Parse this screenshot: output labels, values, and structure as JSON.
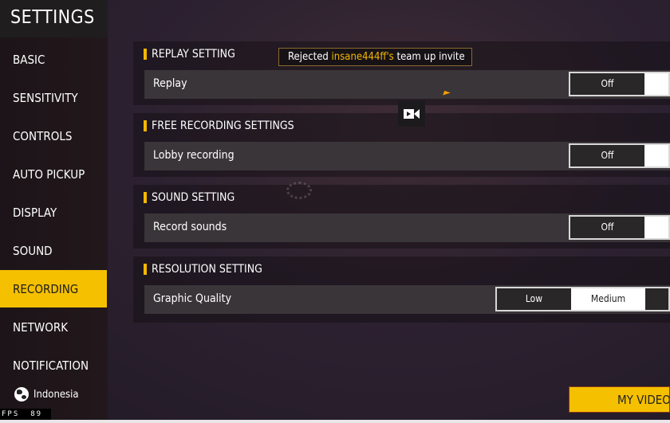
{
  "sidebar": {
    "title": "SETTINGS",
    "items": [
      {
        "label": "BASIC"
      },
      {
        "label": "SENSITIVITY"
      },
      {
        "label": "CONTROLS"
      },
      {
        "label": "AUTO PICKUP"
      },
      {
        "label": "DISPLAY"
      },
      {
        "label": "SOUND"
      },
      {
        "label": "RECORDING",
        "active": true
      },
      {
        "label": "NETWORK"
      },
      {
        "label": "NOTIFICATION"
      }
    ],
    "language": "Indonesia",
    "fps_label": "FPS",
    "fps_value": "89"
  },
  "toast": {
    "prefix": "Rejected",
    "player": "insane444ff's",
    "suffix": "team up invite"
  },
  "sections": [
    {
      "title": "REPLAY SETTING",
      "row": "Replay",
      "value": "Off"
    },
    {
      "title": "FREE RECORDING SETTINGS",
      "row": "Lobby recording",
      "value": "Off"
    },
    {
      "title": "SOUND SETTING",
      "row": "Record sounds",
      "value": "Off"
    },
    {
      "title": "RESOLUTION SETTING",
      "row": "Graphic Quality",
      "options": [
        "Low",
        "Medium"
      ],
      "selected": "Medium"
    }
  ],
  "my_videos_label": "MY VIDEOS",
  "colors": {
    "accent": "#f5c000",
    "highlight": "#f5b800"
  },
  "icons": {
    "video": "video-camera-icon",
    "globe": "globe-icon"
  }
}
